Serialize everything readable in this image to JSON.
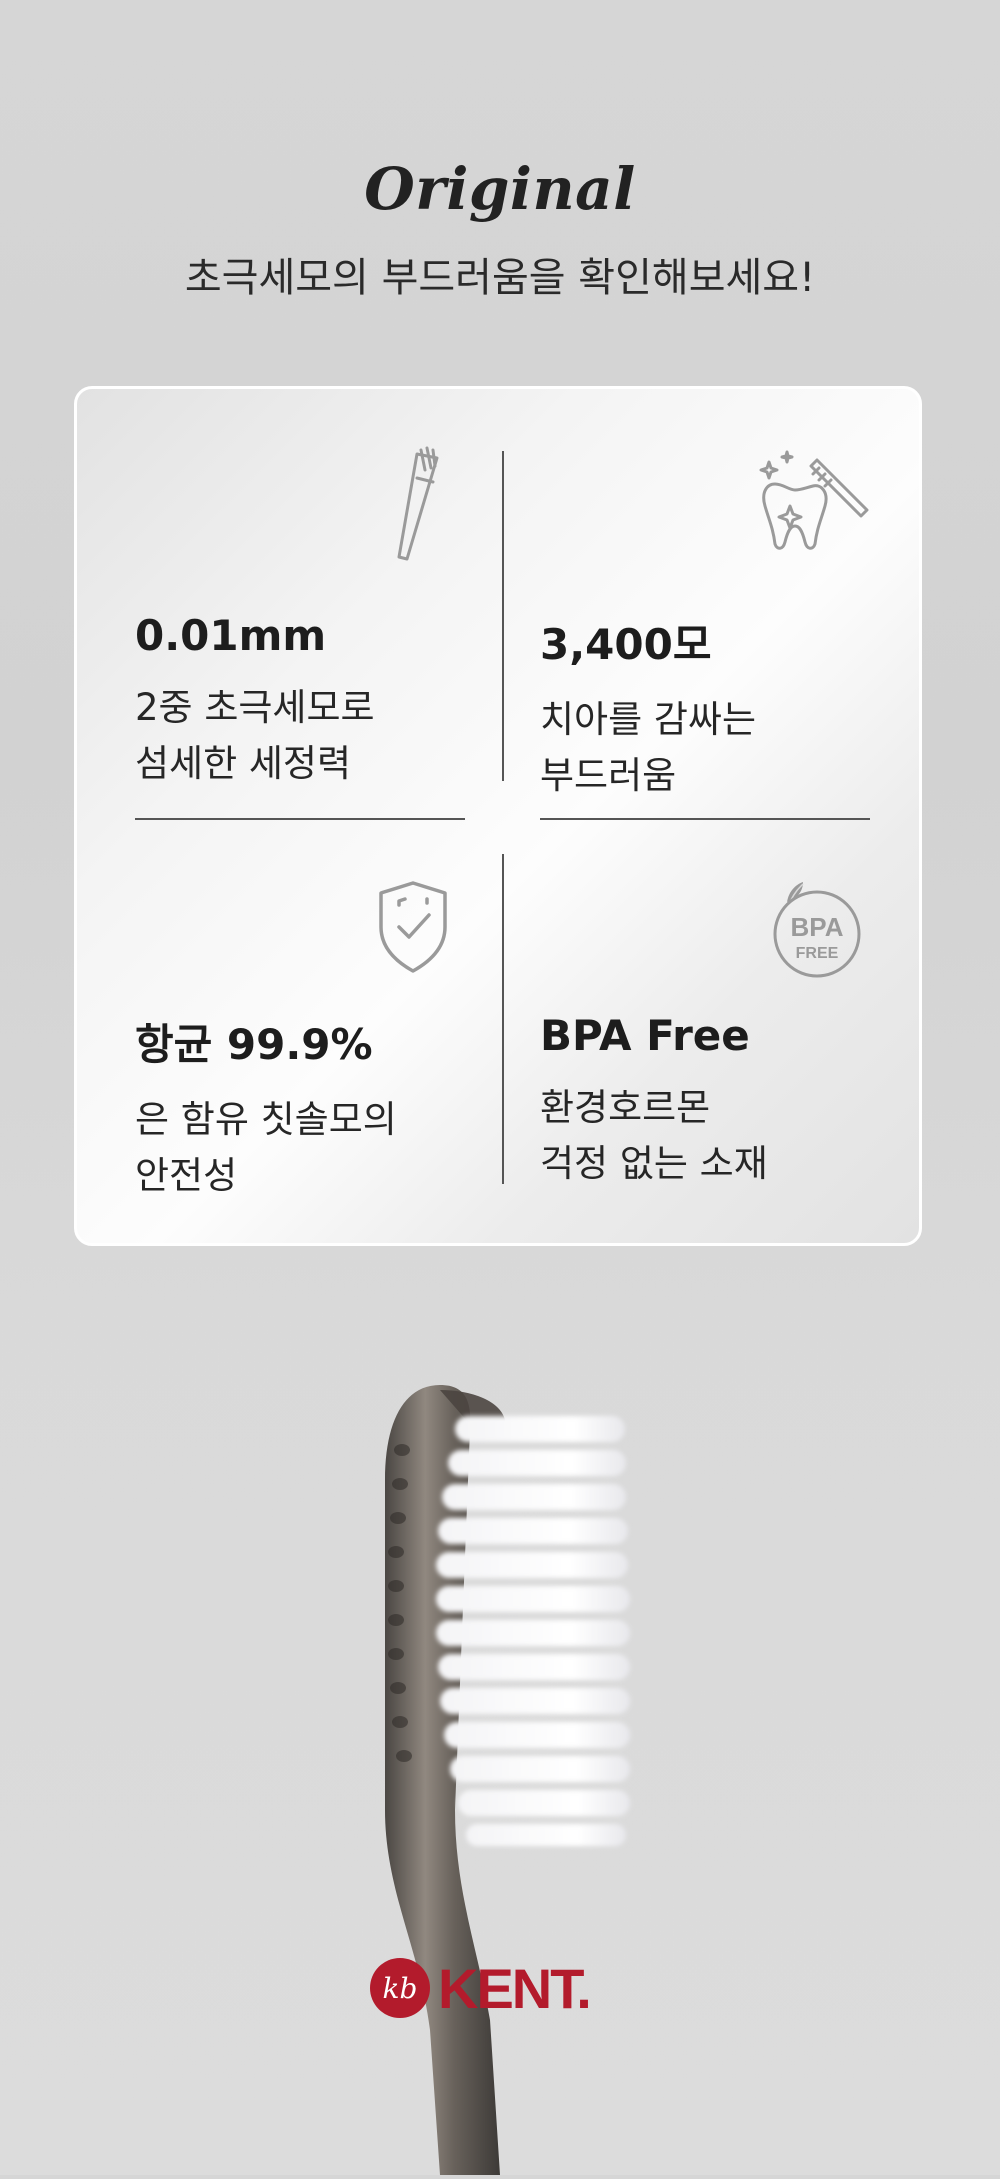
{
  "header": {
    "title": "Original",
    "subtitle": "초극세모의 부드러움을 확인해보세요!"
  },
  "features": [
    {
      "icon": "toothbrush-icon",
      "title": "0.01mm",
      "desc_line1": "2중 초극세모로",
      "desc_line2": "섬세한 세정력"
    },
    {
      "icon": "tooth-sparkle-icon",
      "title": "3,400모",
      "desc_line1": "치아를 감싸는",
      "desc_line2": "부드러움"
    },
    {
      "icon": "shield-check-icon",
      "title": "항균 99.9%",
      "desc_line1": "은 함유 칫솔모의",
      "desc_line2": "안전성"
    },
    {
      "icon": "bpa-free-badge-icon",
      "title": "BPA Free",
      "desc_line1": "환경호르몬",
      "desc_line2": "걱정 없는 소재"
    }
  ],
  "badge": {
    "line1": "BPA",
    "line2": "FREE"
  },
  "brand": {
    "monogram": "kb",
    "name": "KENT.",
    "color": "#b31b2c"
  },
  "colors": {
    "icon_gray": "#9a9a9a",
    "divider": "#555555",
    "text": "#1f1f1f"
  }
}
